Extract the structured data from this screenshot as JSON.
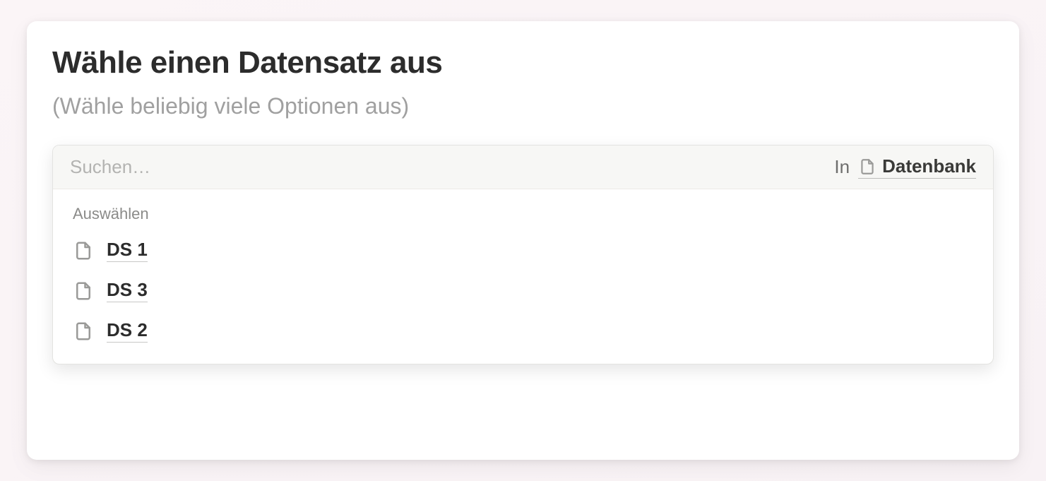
{
  "title": "Wähle einen Datensatz aus",
  "subtitle": "(Wähle beliebig viele Optionen aus)",
  "search": {
    "placeholder": "Suchen…",
    "value": "",
    "in_label": "In",
    "database_label": "Datenbank"
  },
  "select_heading": "Auswählen",
  "options": [
    {
      "label": "DS 1"
    },
    {
      "label": "DS 3"
    },
    {
      "label": "DS 2"
    }
  ]
}
